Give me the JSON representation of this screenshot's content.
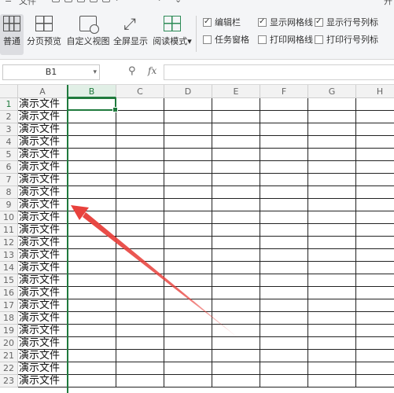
{
  "quick_access": {
    "file_label": "文件",
    "overflow_label": "开"
  },
  "ribbon": {
    "buttons": [
      {
        "id": "normal",
        "label": "普通",
        "icon": "grid-view-icon",
        "active": true
      },
      {
        "id": "page-break",
        "label": "分页预览",
        "icon": "page-break-icon",
        "active": false
      },
      {
        "id": "custom-view",
        "label": "自定义视图",
        "icon": "custom-view-icon",
        "active": false
      },
      {
        "id": "fullscreen",
        "label": "全屏显示",
        "icon": "fullscreen-icon",
        "active": false
      },
      {
        "id": "reading-mode",
        "label": "阅读模式",
        "icon": "reading-mode-icon",
        "active": false,
        "has_dropdown": true
      }
    ],
    "checkboxes": [
      {
        "label": "编辑栏",
        "checked": true
      },
      {
        "label": "显示网格线",
        "checked": true
      },
      {
        "label": "显示行号列标",
        "checked": true
      },
      {
        "label": "任务窗格",
        "checked": false
      },
      {
        "label": "打印网格线",
        "checked": false
      },
      {
        "label": "打印行号列标",
        "checked": false
      }
    ]
  },
  "formula_bar": {
    "name_box": "B1",
    "fx_label": "fx",
    "value": ""
  },
  "sheet": {
    "columns": [
      "A",
      "B",
      "C",
      "D",
      "E",
      "F",
      "G",
      "H"
    ],
    "selected_column": "B",
    "active_cell": "B1",
    "rows": [
      {
        "n": "1",
        "a": "演示文件"
      },
      {
        "n": "2",
        "a": "演示文件"
      },
      {
        "n": "3",
        "a": "演示文件"
      },
      {
        "n": "4",
        "a": "演示文件"
      },
      {
        "n": "5",
        "a": "演示文件"
      },
      {
        "n": "6",
        "a": "演示文件"
      },
      {
        "n": "7",
        "a": "演示文件"
      },
      {
        "n": "8",
        "a": "演示文件"
      },
      {
        "n": "9",
        "a": "演示文件"
      },
      {
        "n": "10",
        "a": "演示文件"
      },
      {
        "n": "11",
        "a": "演示文件"
      },
      {
        "n": "12",
        "a": "演示文件"
      },
      {
        "n": "13",
        "a": "演示文件"
      },
      {
        "n": "14",
        "a": "演示文件"
      },
      {
        "n": "15",
        "a": "演示文件"
      },
      {
        "n": "16",
        "a": "演示文件"
      },
      {
        "n": "17",
        "a": "演示文件"
      },
      {
        "n": "18",
        "a": "演示文件"
      },
      {
        "n": "19",
        "a": "演示文件"
      },
      {
        "n": "20",
        "a": "演示文件"
      },
      {
        "n": "21",
        "a": "演示文件"
      },
      {
        "n": "22",
        "a": "演示文件"
      },
      {
        "n": "23",
        "a": "演示文件"
      }
    ]
  },
  "annotation": {
    "arrow_color": "#e8413c"
  },
  "colors": {
    "selection": "#1f7a3d",
    "ribbon_bg": "#f4f5f7"
  }
}
